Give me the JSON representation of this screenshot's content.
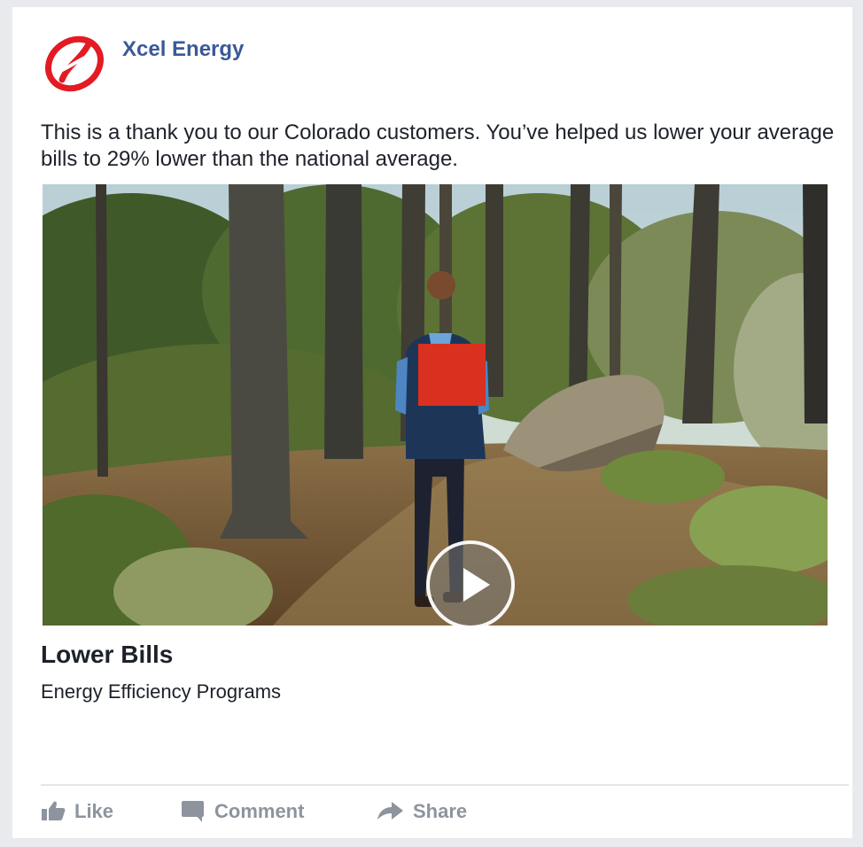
{
  "post": {
    "page_name": "Xcel Energy",
    "text": "This is a thank you to our Colorado customers. You’ve helped us lower your average bills to 29% lower than the national average.",
    "link": {
      "title": "Lower Bills",
      "subtitle": "Energy Efficiency Programs"
    }
  },
  "actions": {
    "like": "Like",
    "comment": "Comment",
    "share": "Share"
  },
  "colors": {
    "brand_blue": "#3b5998",
    "logo_red": "#e31b23",
    "action_gray": "#8d949e"
  }
}
